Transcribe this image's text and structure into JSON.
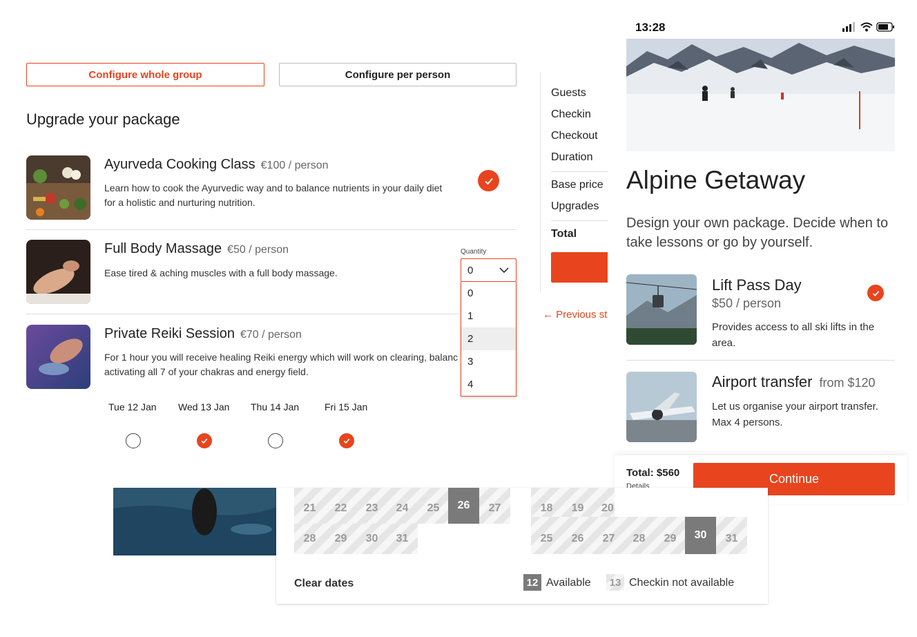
{
  "tabs": {
    "group": "Configure whole group",
    "person": "Configure per person"
  },
  "upgrade_heading": "Upgrade your package",
  "items": [
    {
      "title": "Ayurveda Cooking Class",
      "price": "€100 / person",
      "desc": "Learn how to cook the Ayurvedic way and to balance nutrients in your daily diet for a holistic and nurturing nutrition.",
      "selected": true
    },
    {
      "title": "Full Body Massage",
      "price": "€50 / person",
      "desc": "Ease tired & aching muscles with a full body massage."
    },
    {
      "title": "Private Reiki Session",
      "price": "€70 / person",
      "desc": "For 1 hour you will receive healing Reiki energy which will work on clearing, balanc activating all 7 of your chakras and energy field."
    }
  ],
  "quantity": {
    "label": "Quantity",
    "value": "0",
    "options": [
      "0",
      "1",
      "2",
      "3",
      "4"
    ],
    "highlighted": "2"
  },
  "days": [
    {
      "label": "Tue 12 Jan",
      "checked": false
    },
    {
      "label": "Wed 13 Jan",
      "checked": true
    },
    {
      "label": "Thu 14 Jan",
      "checked": false
    },
    {
      "label": "Fri 15 Jan",
      "checked": true
    }
  ],
  "summary": {
    "guests": "Guests",
    "checkin": "Checkin",
    "checkout": "Checkout",
    "duration": "Duration",
    "base_price": "Base price",
    "upgrades": "Upgrades",
    "total": "Total",
    "previous": "← Previous st"
  },
  "phone": {
    "time": "13:28",
    "title": "Alpine Getaway",
    "subtitle": "Design your own package. Decide when to take lessons or go by yourself.",
    "items": [
      {
        "title": "Lift Pass Day",
        "price": "$50 / person",
        "desc": "Provides access to all ski lifts in the area.",
        "selected": true
      },
      {
        "title": "Airport transfer",
        "price": "from $120",
        "desc": "Let us organise your airport transfer. Max 4 persons."
      }
    ],
    "total": "Total: $560",
    "details": "Details",
    "continue": "Continue"
  },
  "calendar": {
    "left_rows": [
      [
        "21",
        "22",
        "23",
        "24",
        "25",
        "26",
        "27"
      ],
      [
        "28",
        "29",
        "30",
        "31"
      ]
    ],
    "left_selected": "26",
    "right_rows": [
      [
        "18",
        "19",
        "20"
      ],
      [
        "25",
        "26",
        "27",
        "28",
        "29",
        "30",
        "31"
      ]
    ],
    "right_selected": "30",
    "clear": "Clear dates",
    "legend_available_num": "12",
    "legend_available": "Available",
    "legend_na_num": "13",
    "legend_na": "Checkin not available"
  },
  "colors": {
    "accent": "#e8441e",
    "selected_day": "#7a7a7a"
  }
}
